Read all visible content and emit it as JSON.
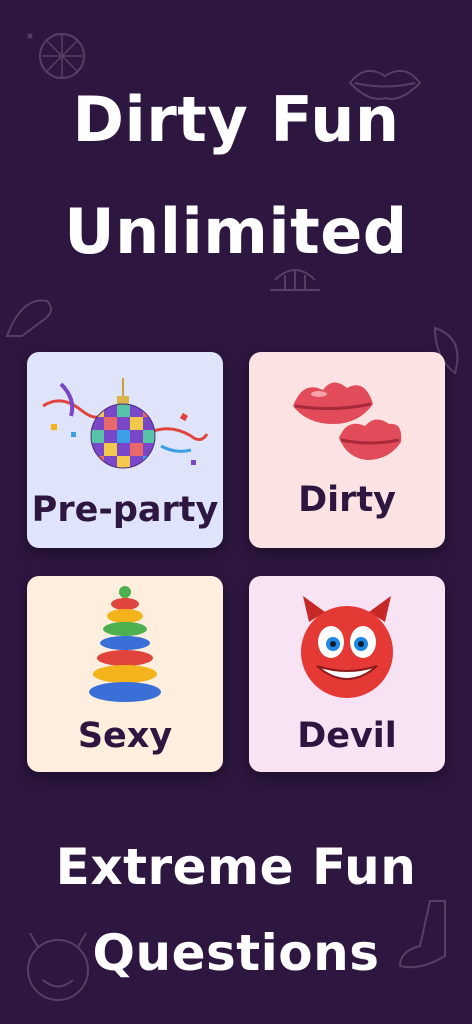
{
  "hero": {
    "line1": "Dirty Fun",
    "line2": "Unlimited"
  },
  "categories": [
    {
      "label": "Pre-party",
      "icon": "disco-ball-icon",
      "bg": "#dfe4fb"
    },
    {
      "label": "Dirty",
      "icon": "lips-icon",
      "bg": "#fce3e3"
    },
    {
      "label": "Sexy",
      "icon": "ring-stack-icon",
      "bg": "#fdeedd"
    },
    {
      "label": "Devil",
      "icon": "devil-face-icon",
      "bg": "#f7e3f3"
    }
  ],
  "footer": {
    "line1": "Extreme Fun",
    "line2": "Questions"
  },
  "colors": {
    "background": "#2d1640",
    "label_text": "#2d1640",
    "headline_text": "#ffffff"
  }
}
